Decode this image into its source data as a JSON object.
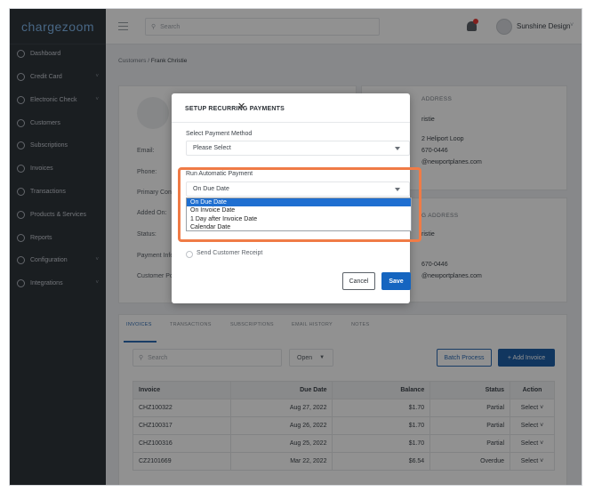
{
  "logo": "chargezoom",
  "search": {
    "placeholder": "Search"
  },
  "user": {
    "name": "Sunshine Design"
  },
  "sidebar": {
    "items": [
      {
        "label": "Dashboard",
        "icon": "home-icon"
      },
      {
        "label": "Credit Card",
        "icon": "credit-card-icon",
        "chevron": "˅"
      },
      {
        "label": "Electronic Check",
        "icon": "check-icon",
        "chevron": "˅"
      },
      {
        "label": "Customers",
        "icon": "users-icon"
      },
      {
        "label": "Subscriptions",
        "icon": "refresh-icon"
      },
      {
        "label": "Invoices",
        "icon": "invoice-icon"
      },
      {
        "label": "Transactions",
        "icon": "dollar-icon"
      },
      {
        "label": "Products & Services",
        "icon": "box-icon"
      },
      {
        "label": "Reports",
        "icon": "chart-icon"
      },
      {
        "label": "Configuration",
        "icon": "gear-icon",
        "chevron": "˅"
      },
      {
        "label": "Integrations",
        "icon": "plug-icon",
        "chevron": "˅"
      }
    ]
  },
  "breadcrumb": {
    "parent": "Customers",
    "sep": " / ",
    "current": "Frank Christie"
  },
  "customer": {
    "labels": [
      "Email:",
      "Phone:",
      "Primary Con",
      "Added On:",
      "Status:",
      "Payment Info",
      "Customer Po"
    ]
  },
  "billing": {
    "heading": "ADDRESS",
    "name": "ristie",
    "line1": "2 Heliport Loop",
    "phone": "670-0446",
    "email": "@newportplanes.com"
  },
  "shipping": {
    "heading": "G ADDRESS",
    "name": "ristie",
    "phone": "670-0446",
    "email": "@newportplanes.com"
  },
  "tabs": [
    "INVOICES",
    "TRANSACTIONS",
    "SUBSCRIPTIONS",
    "EMAIL HISTORY",
    "NOTES"
  ],
  "list": {
    "search_placeholder": "Search",
    "status_filter": "Open",
    "batch_label": "Batch Process",
    "add_label": "+ Add Invoice"
  },
  "table": {
    "headers": [
      "Invoice",
      "Due Date",
      "Balance",
      "Status",
      "Action"
    ],
    "rows": [
      {
        "invoice": "CHZ100322",
        "due": "Aug 27, 2022",
        "balance": "$1.70",
        "status": "Partial",
        "action": "Select"
      },
      {
        "invoice": "CHZ100317",
        "due": "Aug 26, 2022",
        "balance": "$1.70",
        "status": "Partial",
        "action": "Select"
      },
      {
        "invoice": "CHZ100316",
        "due": "Aug 25, 2022",
        "balance": "$1.70",
        "status": "Partial",
        "action": "Select"
      },
      {
        "invoice": "CZ2101669",
        "due": "Mar 22, 2022",
        "balance": "$6.54",
        "status": "Overdue",
        "action": "Select"
      }
    ]
  },
  "modal": {
    "title": "SETUP RECURRING PAYMENTS",
    "close": "✕",
    "payment_method_label": "Select Payment Method",
    "payment_method_value": "Please Select",
    "run_label": "Run Automatic Payment",
    "run_value": "On Due Date",
    "run_options": [
      "On Due Date",
      "On Invoice Date",
      "1 Day after Invoice Date",
      "Calendar Date"
    ],
    "receipt_label": "Send Customer Receipt",
    "cancel_label": "Cancel",
    "save_label": "Save"
  },
  "colors": {
    "accent": "#1565c0",
    "highlight": "#f07b46",
    "sidebar": "#2f353b"
  }
}
